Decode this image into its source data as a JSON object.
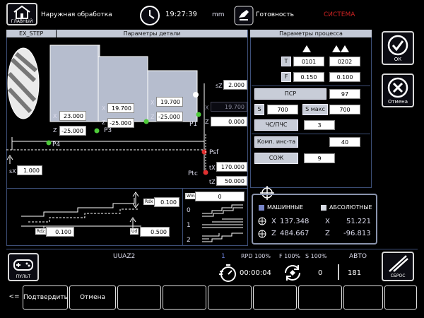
{
  "topbar": {
    "home_label": "ГЛАВНЫЙ",
    "title": "Наружная обработка",
    "time": "19:27:39",
    "units": "mm",
    "ready": "Готовность",
    "system": "СИСТЕМА"
  },
  "part": {
    "tab": "EX_STEP",
    "header": "Параметры детали",
    "x1": "23.000",
    "z1": "-25.000",
    "x2": "19.700",
    "z2": "-25.000",
    "x3": "19.700",
    "z3": "-25.000",
    "p4": "P4",
    "p3": "P3",
    "p1": "P1",
    "sz_label": "sZ",
    "sz": "2.000",
    "xp_label": "X",
    "xp": "19.700",
    "zp_label": "Z",
    "zp": "0.000",
    "psf": "Psf",
    "ptc": "Ptc",
    "sx_label": "sX",
    "sx": "1.000",
    "tx_label": "tX",
    "tx": "170.000",
    "tz_label": "tZ",
    "tz": "50.000",
    "rdx_label": "Rdx",
    "rdx": "0.100",
    "rdz_label": "Rdz",
    "rdz": "0.100",
    "ud_label": "Ud",
    "ud": "0.500",
    "wm_label": "Wm",
    "wm": "0",
    "modes": [
      "0",
      "1",
      "2"
    ]
  },
  "process": {
    "header": "Параметры процесса",
    "rows": [
      {
        "label": "T",
        "a": "0101",
        "b": "0202"
      },
      {
        "label": "F",
        "a": "0.150",
        "b": "0.100"
      }
    ],
    "psr_label": "ПСР",
    "psr": "97",
    "s_label": "S",
    "s": "700",
    "smax_label": "S макс",
    "smax": "700",
    "chs_label": "ЧС/ПЧС",
    "chs": "3",
    "comp_label": "Комп. инс-та",
    "comp": "40",
    "coolant_label": "СОЖ",
    "coolant": "9"
  },
  "coords": {
    "machine_label": "МАШИННЫЕ",
    "abs_label": "АБСОЛЮТНЫЕ",
    "mx_label": "X",
    "mx": "137.348",
    "mz_label": "Z",
    "mz": "484.667",
    "ax_label": "X",
    "ax": "51.221",
    "az_label": "Z",
    "az": "-96.813"
  },
  "right": {
    "ok": "ОК",
    "cancel": "Отмена"
  },
  "status": {
    "pult": "ПУЛЬТ",
    "program": "UUAZ2",
    "channel": "1",
    "rpd": "RPD 100%",
    "f": "F 100%",
    "s": "S 100%",
    "mode": "АВТО",
    "time": "00:00:04",
    "counter": "0",
    "line": "181",
    "reset": "СБРОС"
  },
  "fkeys": {
    "back": "<=",
    "confirm": "Подтвердить",
    "cancel": "Отмена"
  },
  "colors": {
    "background": "#000000",
    "panel_header": "#c3c9d6",
    "accent_red": "#e03030",
    "point_green": "#4ecb3a"
  }
}
